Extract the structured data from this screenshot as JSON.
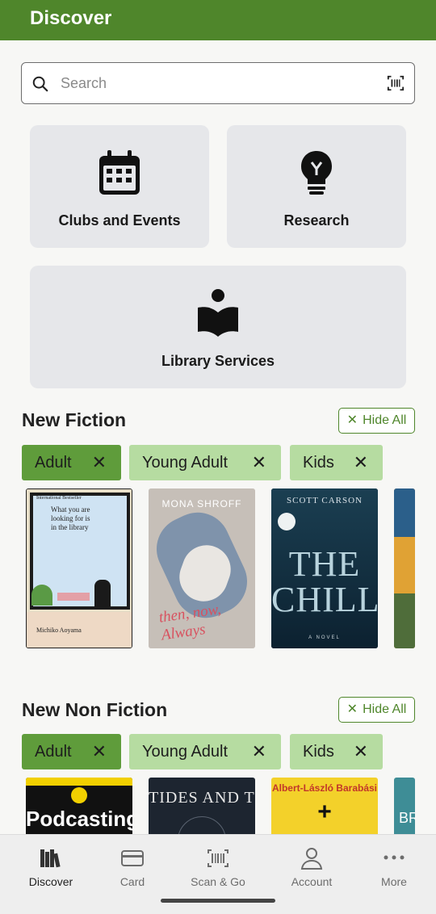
{
  "header": {
    "title": "Discover"
  },
  "search": {
    "placeholder": "Search"
  },
  "tiles": [
    {
      "label": "Clubs and Events",
      "icon": "calendar-icon"
    },
    {
      "label": "Research",
      "icon": "lightbulb-icon"
    },
    {
      "label": "Library Services",
      "icon": "reader-icon"
    }
  ],
  "sections": [
    {
      "title": "New Fiction",
      "hide_all": "Hide All",
      "chips": [
        {
          "label": "Adult",
          "active": true
        },
        {
          "label": "Young Adult",
          "active": false
        },
        {
          "label": "Kids",
          "active": false
        }
      ],
      "books": [
        {
          "author": "Michiko Aoyama",
          "title": "What you are looking for is in the library",
          "tag": "International Bestseller"
        },
        {
          "author": "MONA SHROFF",
          "title": "then, now, Always"
        },
        {
          "author": "SCOTT CARSON",
          "title": "THE CHILL",
          "subtitle": "A NOVEL"
        },
        {
          "author": "",
          "title": ""
        }
      ]
    },
    {
      "title": "New Non Fiction",
      "hide_all": "Hide All",
      "chips": [
        {
          "label": "Adult",
          "active": true
        },
        {
          "label": "Young Adult",
          "active": false
        },
        {
          "label": "Kids",
          "active": false
        }
      ],
      "books": [
        {
          "title": "Podcasting"
        },
        {
          "title": "TIDES AND THE OCEAN"
        },
        {
          "author": "Albert-László Barabási",
          "title": "+"
        },
        {
          "title": "BR"
        }
      ]
    }
  ],
  "bottom_nav": [
    {
      "label": "Discover",
      "icon": "books-icon",
      "active": true
    },
    {
      "label": "Card",
      "icon": "card-icon",
      "active": false
    },
    {
      "label": "Scan & Go",
      "icon": "barcode-icon",
      "active": false
    },
    {
      "label": "Account",
      "icon": "person-icon",
      "active": false
    },
    {
      "label": "More",
      "icon": "more-dots-icon",
      "active": false
    }
  ],
  "colors": {
    "brand": "#4f862b",
    "chip_active": "#5f9c3b",
    "chip_inactive": "#b6dca1"
  }
}
